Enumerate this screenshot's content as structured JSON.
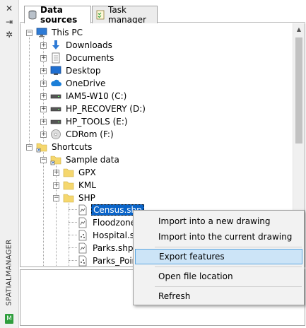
{
  "sidebar": {
    "close_icon": "✕",
    "pin_icon": "⇥",
    "settings_icon": "✲",
    "vertical_title": "SPATIALMANAGER",
    "bottom_icon": "M"
  },
  "tabs": [
    {
      "label": "Data sources",
      "active": true
    },
    {
      "label": "Task manager",
      "active": false
    }
  ],
  "tree": {
    "this_pc": "This PC",
    "downloads": "Downloads",
    "documents": "Documents",
    "desktop": "Desktop",
    "onedrive": "OneDrive",
    "drive_c": "IAM5-W10 (C:)",
    "drive_d": "HP_RECOVERY (D:)",
    "drive_e": "HP_TOOLS (E:)",
    "drive_f": "CDRom (F:)",
    "shortcuts": "Shortcuts",
    "sample_data": "Sample data",
    "gpx": "GPX",
    "kml": "KML",
    "shp": "SHP",
    "files": [
      "Census.shp",
      "Floodzone.",
      "Hospital.sh",
      "Parks.shp",
      "Parks_Poin"
    ]
  },
  "context_menu": {
    "import_new": "Import into a new drawing",
    "import_current": "Import into the current drawing",
    "export": "Export features",
    "open_location": "Open file location",
    "refresh": "Refresh"
  },
  "colors": {
    "folder": "#f5d76e",
    "selection": "#0a64c8",
    "menu_highlight": "#cce4f7",
    "pc_blue": "#2e7bd6",
    "green": "#2e9e3d"
  }
}
